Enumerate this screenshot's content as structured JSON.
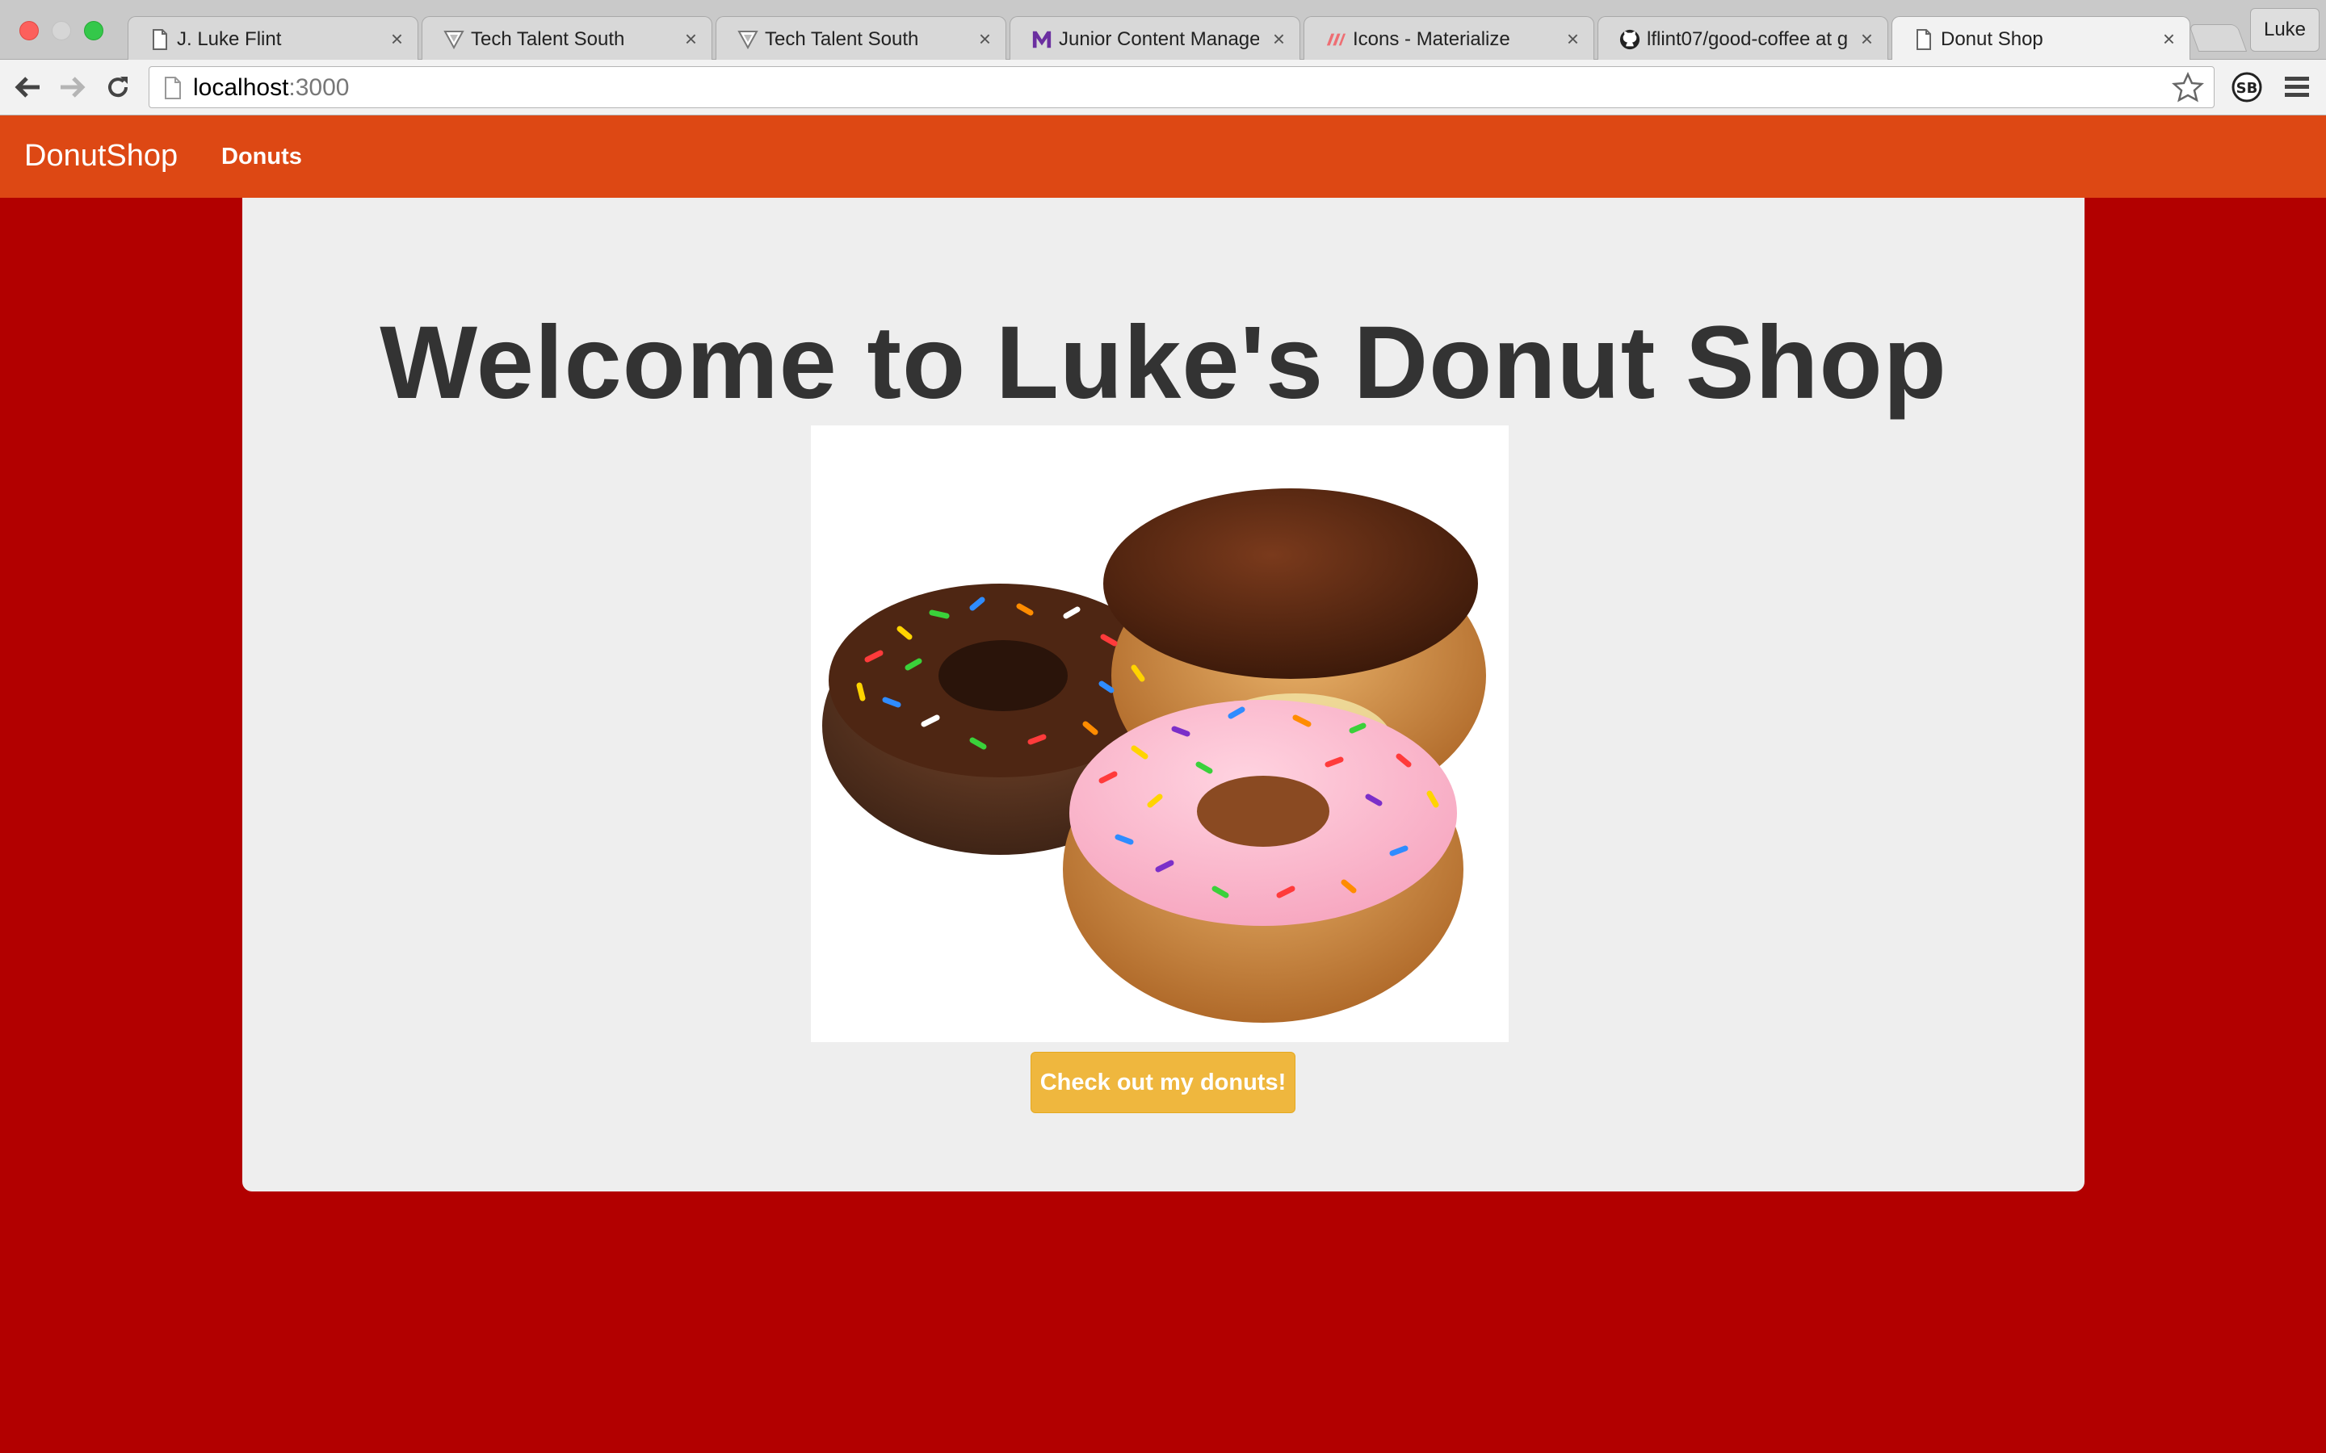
{
  "browser": {
    "tabs": [
      {
        "title": "J. Luke Flint",
        "icon": "page-icon",
        "active": false
      },
      {
        "title": "Tech Talent South",
        "icon": "tts-logo-icon",
        "active": false
      },
      {
        "title": "Tech Talent South",
        "icon": "tts-logo-icon",
        "active": false
      },
      {
        "title": "Junior Content Manager",
        "icon": "m-logo-icon",
        "active": false
      },
      {
        "title": "Icons - Materialize",
        "icon": "materialize-logo-icon",
        "active": false
      },
      {
        "title": "lflint07/good-coffee at g",
        "icon": "github-icon",
        "active": false
      },
      {
        "title": "Donut Shop",
        "icon": "page-icon",
        "active": true
      }
    ],
    "tab_close_glyph": "×",
    "profile_name": "Luke",
    "url_host": "localhost",
    "url_port": ":3000",
    "extension_label": "SB"
  },
  "navbar": {
    "brand": "DonutShop",
    "links": [
      "Donuts"
    ]
  },
  "main": {
    "heading": "Welcome to Luke's Donut Shop",
    "cta_label": "Check out my donuts!"
  },
  "colors": {
    "navbar": "#dd4814",
    "page_background": "#b20000",
    "jumbotron": "#eeeeee",
    "cta": "#efb73e"
  }
}
